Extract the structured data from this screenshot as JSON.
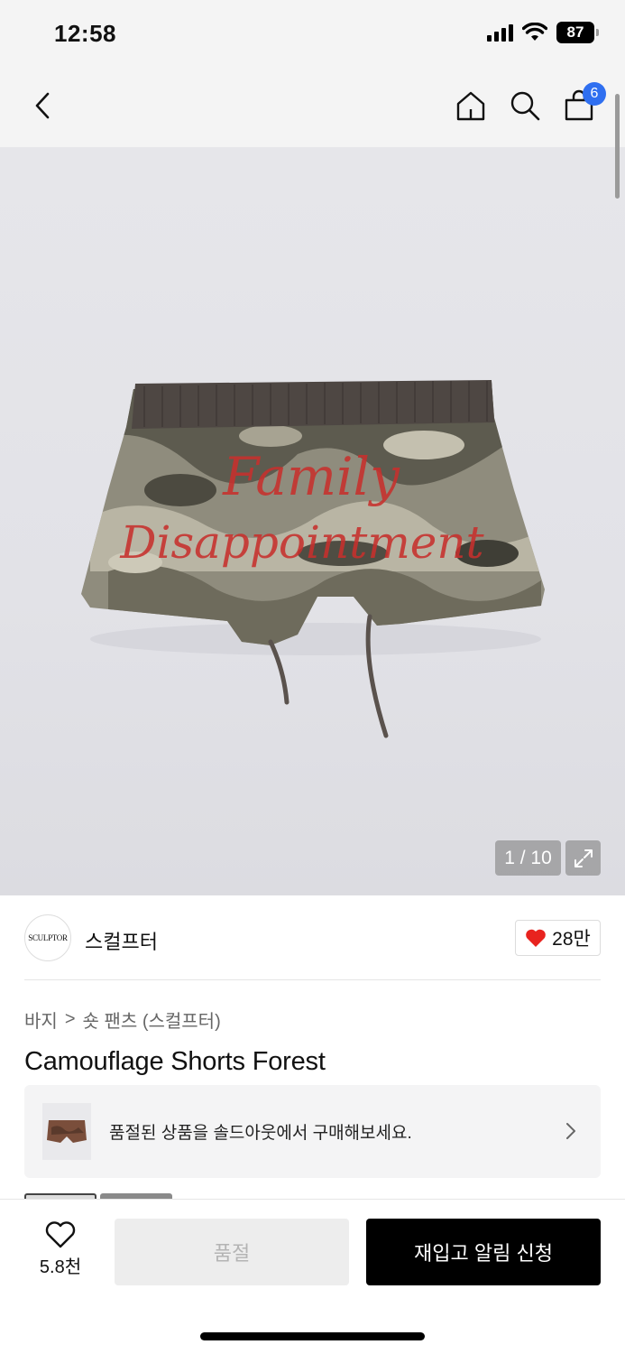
{
  "status_bar": {
    "time": "12:58",
    "battery": "87"
  },
  "nav": {
    "cart_count": "6",
    "icons": [
      "back-chevron-icon",
      "home-icon",
      "search-icon",
      "shopping-bag-icon"
    ]
  },
  "gallery": {
    "image_text_line1": "Family",
    "image_text_line2": "Disappointment",
    "counter": "1 / 10"
  },
  "brand": {
    "logo_text": "SCULPTOR",
    "name": "스컬프터",
    "likes": "28만"
  },
  "product": {
    "breadcrumb": [
      "바지",
      "숏 팬츠 (스컬프터)"
    ],
    "breadcrumb_separator": ">",
    "title": "Camouflage Shorts Forest"
  },
  "soldout_banner": {
    "text": "품절된 상품을 솔드아웃에서 구매해보세요."
  },
  "bottom_bar": {
    "wish_count": "5.8천",
    "soldout_label": "품절",
    "restock_label": "재입고 알림 신청"
  },
  "colors": {
    "accent_badge": "#2f6ff0",
    "heart": "#e8231f",
    "primary_button": "#000000",
    "disabled_button": "#ededed"
  }
}
